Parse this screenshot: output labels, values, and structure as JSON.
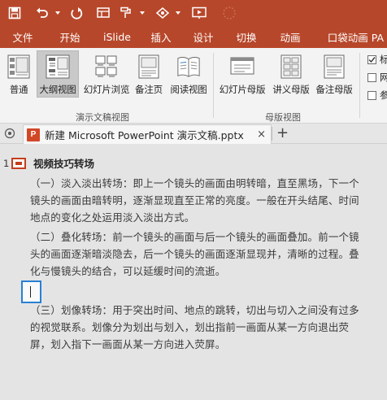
{
  "quick_access": {
    "items": [
      "save-icon",
      "undo-icon",
      "redo-icon",
      "layout-icon",
      "format-painter-icon",
      "shape-icon",
      "slideshow-icon",
      "loading-icon"
    ]
  },
  "tabs": [
    "文件",
    "开始",
    "iSlide",
    "插入",
    "设计",
    "切换",
    "动画",
    "口袋动画 PA"
  ],
  "ribbon": {
    "presentation_views": {
      "label": "演示文稿视图",
      "buttons": [
        "普通",
        "大纲视图",
        "幻灯片浏览",
        "备注页",
        "阅读视图"
      ],
      "active": "大纲视图"
    },
    "master_views": {
      "label": "母版视图",
      "buttons": [
        "幻灯片母版",
        "讲义母版",
        "备注母版"
      ]
    },
    "show_checks": [
      "标",
      "网",
      "参"
    ]
  },
  "document": {
    "tab_title": "新建 Microsoft PowerPoint 演示文稿.pptx",
    "file_icon_letter": "P",
    "close": "×",
    "new_tab": "+"
  },
  "outline": {
    "slide_number": "1",
    "slide_title": "视频技巧转场",
    "paragraphs": [
      "（一）淡入淡出转场：即上一个镜头的画面由明转暗，直至黑场，下一个镜头的画面由暗转明，逐渐显现直至正常的亮度。一般在开头结尾、时间地点的变化之处运用淡入淡出方式。",
      "（二）叠化转场：前一个镜头的画面与后一个镜头的画面叠加。前一个镜头的画面逐渐暗淡隐去，后一个镜头的画面逐渐显现并，清晰的过程。叠化与慢镜头的结合，可以延缓时间的流逝。",
      "（三）划像转场：用于突出时间、地点的跳转，切出与切入之间没有过多的视觉联系。划像分为划出与划入，划出指前一画面从某一方向退出荧屏，划入指下一画面从某一方向进入荧屏。"
    ]
  }
}
